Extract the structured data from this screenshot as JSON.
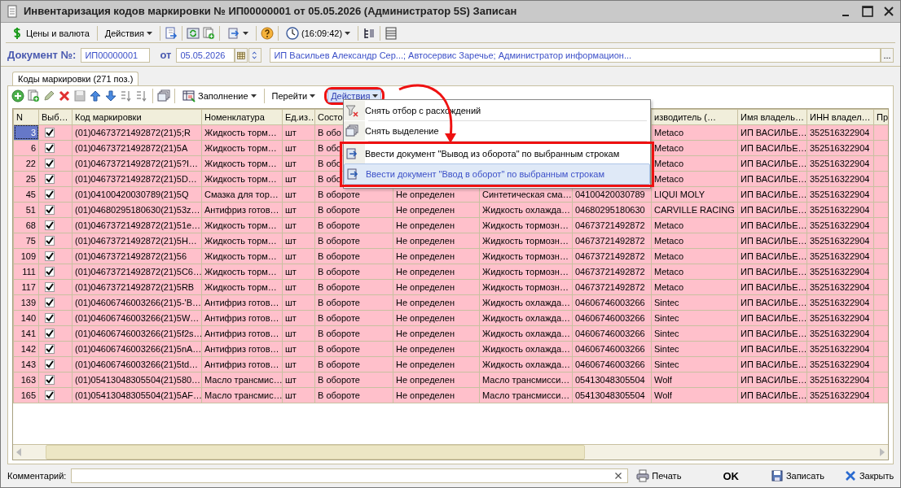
{
  "window": {
    "title": "Инвентаризация кодов маркировки № ИП00000001 от 05.05.2026 (Администратор 5S) Записан"
  },
  "toolbar": [
    "Цены и валюта",
    "Действия",
    "(16:09:42)"
  ],
  "document": {
    "number_label": "Документ №:",
    "number": "ИП00000001",
    "date_label": "от",
    "date": "05.05.2026",
    "info": "ИП Васильев Александр Сер...; Автосервис Заречье; Администратор информацион...",
    "info_button": "..."
  },
  "tabs": [
    {
      "label": "Коды маркировки (271 поз.)",
      "selected": true
    }
  ],
  "table_toolbar": [
    "Заполнение",
    "Перейти",
    "Действия"
  ],
  "actions_menu": {
    "items": [
      {
        "label": "Снять отбор с расхождений",
        "selected": false
      },
      {
        "label": "Снять выделение",
        "selected": false
      },
      {
        "label": "Ввести документ \"Вывод из оборота\" по выбранным строкам",
        "selected": false
      },
      {
        "label": "Ввести документ \"Ввод в оборот\" по выбранным строкам",
        "selected": true
      }
    ]
  },
  "table": {
    "columns": [
      "N",
      "Выб…",
      "Код маркировки",
      "Номенклатура",
      "Ед.из…",
      "Состо",
      null,
      null,
      null,
      "изводитель (…",
      "Имя владель…",
      "ИНН владел…",
      "Пр"
    ],
    "rows": [
      {
        "selected": true,
        "cells": [
          "3",
          {
            "checked": true
          },
          "(01)04673721492872(21)5;R",
          "Жидкость торм…",
          "шт",
          "В обо",
          null,
          null,
          null,
          "Metaco",
          "ИП ВАСИЛЬЕ…",
          "352516322904"
        ]
      },
      {
        "selected": false,
        "cells": [
          "6",
          {
            "checked": true
          },
          "(01)04673721492872(21)5A",
          "Жидкость торм…",
          "шт",
          "В обо",
          null,
          null,
          null,
          "Metaco",
          "ИП ВАСИЛЬЕ…",
          "352516322904"
        ]
      },
      {
        "selected": false,
        "cells": [
          "22",
          {
            "checked": true
          },
          "(01)04673721492872(21)5?I…",
          "Жидкость торм…",
          "шт",
          "В обо",
          null,
          null,
          null,
          "Metaco",
          "ИП ВАСИЛЬЕ…",
          "352516322904"
        ]
      },
      {
        "selected": false,
        "cells": [
          "25",
          {
            "checked": true
          },
          "(01)04673721492872(21)5D…",
          "Жидкость торм…",
          "шт",
          "В обо",
          null,
          null,
          null,
          "Metaco",
          "ИП ВАСИЛЬЕ…",
          "352516322904"
        ]
      },
      {
        "selected": false,
        "cells": [
          "45",
          {
            "checked": true
          },
          "(01)04100420030789(21)5Q",
          "Смазка для тор…",
          "шт",
          "В обороте",
          "Не определен",
          "Синтетическая сма…",
          "04100420030789",
          "LIQUI MOLY",
          "ИП ВАСИЛЬЕ…",
          "352516322904"
        ]
      },
      {
        "selected": false,
        "cells": [
          "51",
          {
            "checked": true
          },
          "(01)04680295180630(21)53z…",
          "Антифриз готов…",
          "шт",
          "В обороте",
          "Не определен",
          "Жидкость охлажда…",
          "04680295180630",
          "CARVILLE RACING",
          "ИП ВАСИЛЬЕ…",
          "352516322904"
        ]
      },
      {
        "selected": false,
        "cells": [
          "68",
          {
            "checked": true
          },
          "(01)04673721492872(21)51e…",
          "Жидкость торм…",
          "шт",
          "В обороте",
          "Не определен",
          "Жидкость тормозн…",
          "04673721492872",
          "Metaco",
          "ИП ВАСИЛЬЕ…",
          "352516322904"
        ]
      },
      {
        "selected": false,
        "cells": [
          "75",
          {
            "checked": true
          },
          "(01)04673721492872(21)5H…",
          "Жидкость торм…",
          "шт",
          "В обороте",
          "Не определен",
          "Жидкость тормозн…",
          "04673721492872",
          "Metaco",
          "ИП ВАСИЛЬЕ…",
          "352516322904"
        ]
      },
      {
        "selected": false,
        "cells": [
          "109",
          {
            "checked": true
          },
          "(01)04673721492872(21)56",
          "Жидкость торм…",
          "шт",
          "В обороте",
          "Не определен",
          "Жидкость тормозн…",
          "04673721492872",
          "Metaco",
          "ИП ВАСИЛЬЕ…",
          "352516322904"
        ]
      },
      {
        "selected": false,
        "cells": [
          "111",
          {
            "checked": true
          },
          "(01)04673721492872(21)5C6…",
          "Жидкость торм…",
          "шт",
          "В обороте",
          "Не определен",
          "Жидкость тормозн…",
          "04673721492872",
          "Metaco",
          "ИП ВАСИЛЬЕ…",
          "352516322904"
        ]
      },
      {
        "selected": false,
        "cells": [
          "117",
          {
            "checked": true
          },
          "(01)04673721492872(21)5RB",
          "Жидкость торм…",
          "шт",
          "В обороте",
          "Не определен",
          "Жидкость тормозн…",
          "04673721492872",
          "Metaco",
          "ИП ВАСИЛЬЕ…",
          "352516322904"
        ]
      },
      {
        "selected": false,
        "cells": [
          "139",
          {
            "checked": true
          },
          "(01)04606746003266(21)5-'B…",
          "Антифриз готов…",
          "шт",
          "В обороте",
          "Не определен",
          "Жидкость охлажда…",
          "04606746003266",
          "Sintec",
          "ИП ВАСИЛЬЕ…",
          "352516322904"
        ]
      },
      {
        "selected": false,
        "cells": [
          "140",
          {
            "checked": true
          },
          "(01)04606746003266(21)5W…",
          "Антифриз готов…",
          "шт",
          "В обороте",
          "Не определен",
          "Жидкость охлажда…",
          "04606746003266",
          "Sintec",
          "ИП ВАСИЛЬЕ…",
          "352516322904"
        ]
      },
      {
        "selected": false,
        "cells": [
          "141",
          {
            "checked": true
          },
          "(01)04606746003266(21)5f2s…",
          "Антифриз готов…",
          "шт",
          "В обороте",
          "Не определен",
          "Жидкость охлажда…",
          "04606746003266",
          "Sintec",
          "ИП ВАСИЛЬЕ…",
          "352516322904"
        ]
      },
      {
        "selected": false,
        "cells": [
          "142",
          {
            "checked": true
          },
          "(01)04606746003266(21)5nA…",
          "Антифриз готов…",
          "шт",
          "В обороте",
          "Не определен",
          "Жидкость охлажда…",
          "04606746003266",
          "Sintec",
          "ИП ВАСИЛЬЕ…",
          "352516322904"
        ]
      },
      {
        "selected": false,
        "cells": [
          "143",
          {
            "checked": true
          },
          "(01)04606746003266(21)5td…",
          "Антифриз готов…",
          "шт",
          "В обороте",
          "Не определен",
          "Жидкость охлажда…",
          "04606746003266",
          "Sintec",
          "ИП ВАСИЛЬЕ…",
          "352516322904"
        ]
      },
      {
        "selected": false,
        "cells": [
          "163",
          {
            "checked": true
          },
          "(01)05413048305504(21)580…",
          "Масло трансмис…",
          "шт",
          "В обороте",
          "Не определен",
          "Масло трансмисси…",
          "05413048305504",
          "Wolf",
          "ИП ВАСИЛЬЕ…",
          "352516322904"
        ]
      },
      {
        "selected": false,
        "cells": [
          "165",
          {
            "checked": true
          },
          "(01)05413048305504(21)5AF…",
          "Масло трансмис…",
          "шт",
          "В обороте",
          "Не определен",
          "Масло трансмисси…",
          "05413048305504",
          "Wolf",
          "ИП ВАСИЛЬЕ…",
          "352516322904"
        ]
      }
    ]
  },
  "footer": {
    "comment_label": "Комментарий:",
    "buttons": [
      "Печать",
      "OK",
      "Записать",
      "Закрыть"
    ]
  }
}
